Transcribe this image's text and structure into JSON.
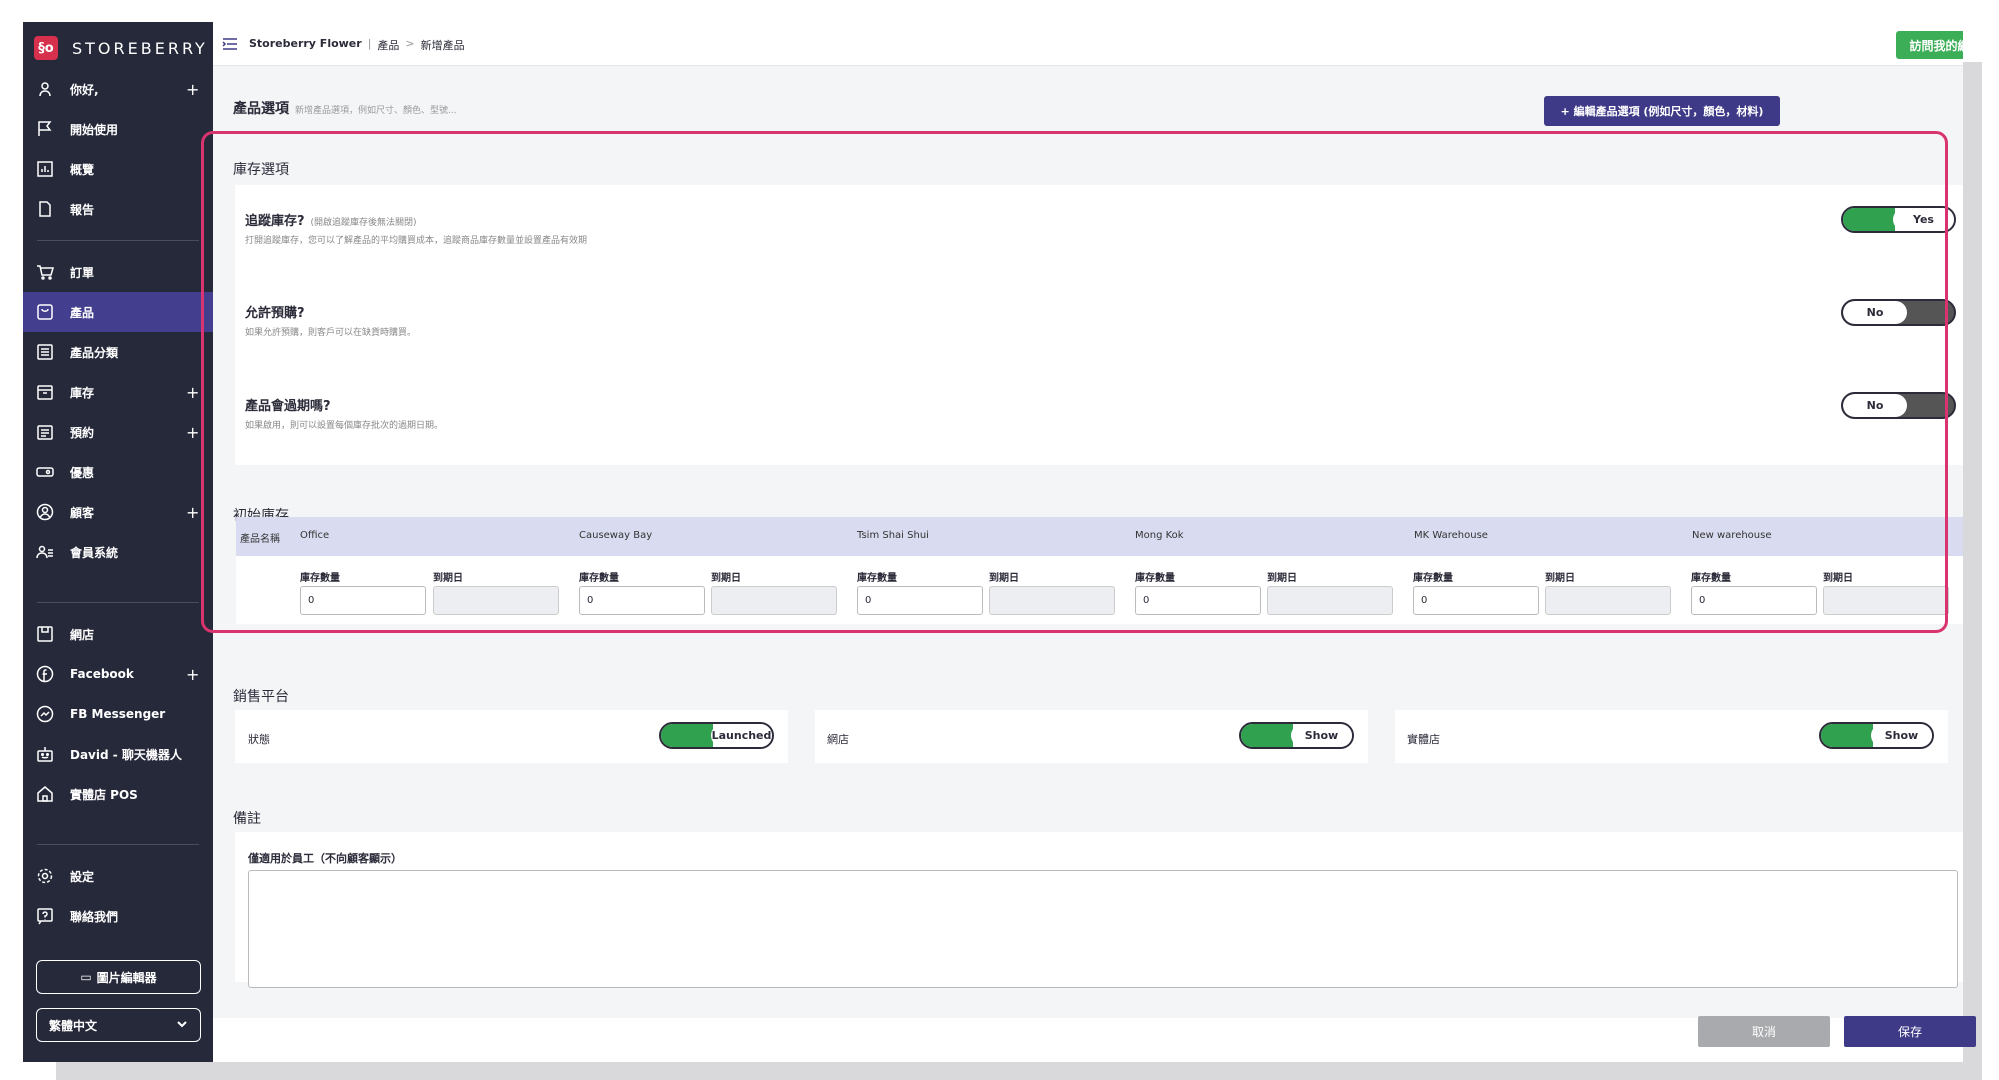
{
  "brand": {
    "logo_text": "§o",
    "name": "STOREBERRY"
  },
  "sidebar": {
    "items": [
      {
        "label": "你好,",
        "plus": "+"
      },
      {
        "label": "開始使用"
      },
      {
        "label": "概覽"
      },
      {
        "label": "報告"
      },
      {
        "label": "訂單"
      },
      {
        "label": "產品"
      },
      {
        "label": "產品分類"
      },
      {
        "label": "庫存",
        "plus": "+"
      },
      {
        "label": "預約",
        "plus": "+"
      },
      {
        "label": "優惠"
      },
      {
        "label": "顧客",
        "plus": "+"
      },
      {
        "label": "會員系統"
      },
      {
        "label": "網店"
      },
      {
        "label": "Facebook",
        "plus": "+"
      },
      {
        "label": "FB Messenger"
      },
      {
        "label": "David - 聊天機器人"
      },
      {
        "label": "實體店 POS"
      },
      {
        "label": "設定"
      },
      {
        "label": "聯絡我們"
      }
    ],
    "image_editor": "圖片編輯器",
    "language": "繁體中文"
  },
  "topbar": {
    "breadcrumb": {
      "store": "Storeberry Flower",
      "sep1": "|",
      "section": "產品",
      "sep2": ">",
      "page": "新增產品"
    },
    "visit_button": "訪問我的網店"
  },
  "product_options": {
    "title": "產品選項",
    "hint": "新增產品選項，例如尺寸、顏色、型號...",
    "edit_button": "+ 編輯產品選項 (例如尺寸，顏色，材料)"
  },
  "inventory_options": {
    "title": "庫存選項",
    "track": {
      "title": "追蹤庫存?",
      "note": "(開啟追蹤庫存後無法關閉)",
      "desc": "打開追蹤庫存，您可以了解產品的平均購買成本，追蹤商品庫存數量並設置產品有效期",
      "value": "Yes"
    },
    "preorder": {
      "title": "允許預購?",
      "desc": "如果允許預購，則客戶可以在缺貨時購買。",
      "value": "No"
    },
    "expire": {
      "title": "產品會過期嗎?",
      "desc": "如果啟用，則可以設置每個庫存批次的過期日期。",
      "value": "No"
    }
  },
  "initial_inventory": {
    "title": "初始庫存",
    "name_header": "產品名稱",
    "qty_label": "庫存數量",
    "date_label": "到期日",
    "locations": [
      {
        "name": "Office",
        "qty": "0"
      },
      {
        "name": "Causeway Bay",
        "qty": "0"
      },
      {
        "name": "Tsim Shai Shui",
        "qty": "0"
      },
      {
        "name": "Mong Kok",
        "qty": "0"
      },
      {
        "name": "MK Warehouse",
        "qty": "0"
      },
      {
        "name": "New warehouse",
        "qty": "0"
      }
    ]
  },
  "sales_channels": {
    "title": "銷售平台",
    "channels": [
      {
        "label": "狀態",
        "value": "Launched"
      },
      {
        "label": "網店",
        "value": "Show"
      },
      {
        "label": "實體店",
        "value": "Show"
      }
    ]
  },
  "remarks": {
    "title": "備註",
    "label": "僅適用於員工（不向顧客顯示）",
    "value": ""
  },
  "footer": {
    "cancel": "取消",
    "save": "保存"
  },
  "colors": {
    "primary": "#3e3a88",
    "success": "#2fa14f",
    "highlight": "#d8346f",
    "sidebar": "#26293a"
  }
}
